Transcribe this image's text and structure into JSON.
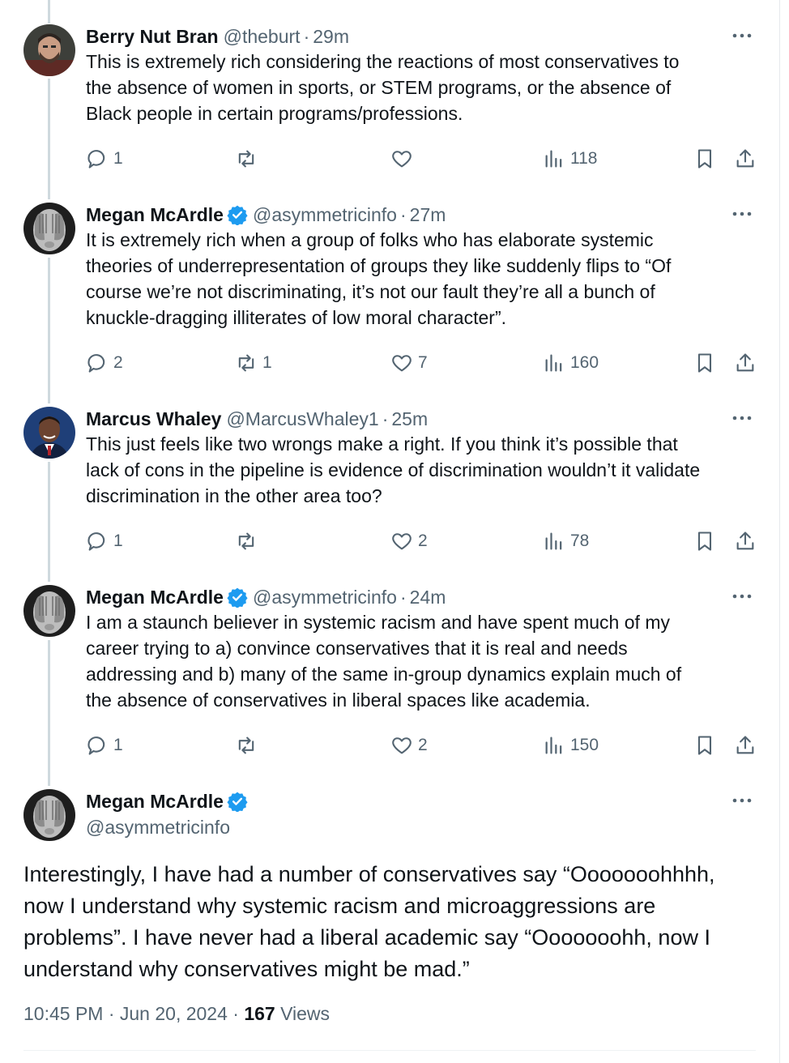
{
  "replies": [
    {
      "name": "Berry Nut Bran",
      "verified": false,
      "handle": "@theburt",
      "time": "29m",
      "lines": [
        "This is extremely rich considering the reactions of most conservatives to",
        "the absence of women in sports, or STEM programs, or the absence of",
        "Black people in certain programs/professions."
      ],
      "replies_count": "1",
      "reposts_count": "",
      "likes_count": "",
      "views_count": "118"
    },
    {
      "name": "Megan McArdle",
      "verified": true,
      "handle": "@asymmetricinfo",
      "time": "27m",
      "lines": [
        "It is extremely rich when a group of folks who has elaborate systemic",
        "theories of underrepresentation of groups they like suddenly flips to “Of",
        "course we’re not discriminating, it’s not our fault they’re all a bunch of",
        "knuckle-dragging illiterates of low moral character”."
      ],
      "replies_count": "2",
      "reposts_count": "1",
      "likes_count": "7",
      "views_count": "160"
    },
    {
      "name": "Marcus Whaley",
      "verified": false,
      "handle": "@MarcusWhaley1",
      "time": "25m",
      "lines": [
        "This just feels like two wrongs make a right.  If you think it’s possible that",
        "lack of cons in the pipeline is evidence of discrimination wouldn’t it validate",
        "discrimination in the other area too?"
      ],
      "replies_count": "1",
      "reposts_count": "",
      "likes_count": "2",
      "views_count": "78"
    },
    {
      "name": "Megan McArdle",
      "verified": true,
      "handle": "@asymmetricinfo",
      "time": "24m",
      "lines": [
        "I am a staunch believer in systemic racism and have spent much of my",
        "career trying to a) convince conservatives that it is real and needs",
        "addressing and b) many of the same in-group dynamics explain much of",
        "the absence of conservatives in liberal spaces like academia."
      ],
      "replies_count": "1",
      "reposts_count": "",
      "likes_count": "2",
      "views_count": "150"
    }
  ],
  "main": {
    "name": "Megan McArdle",
    "handle": "@asymmetricinfo",
    "lines": [
      "Interestingly, I have had a number of conservatives say “Ooooooohhhh,",
      "now I understand why systemic racism and microaggressions are",
      "problems”. I have never had a liberal academic say “Ooooooohh, now I",
      "understand why conservatives might be mad.”"
    ],
    "timestamp": "10:45 PM · Jun 20, 2024 · ",
    "views_count": "167",
    "views_label": " Views"
  },
  "colors": {
    "text": "#0f1419",
    "secondary": "#536471",
    "verified": "#1d9bf0",
    "thread_line": "#cfd9de"
  },
  "icons": {
    "reply": "speech-bubble-icon",
    "repost": "repost-arrows-icon",
    "like": "heart-icon",
    "views": "bar-chart-icon",
    "bookmark": "bookmark-icon",
    "share": "share-upload-icon",
    "more": "more-dots-icon",
    "verified": "verified-badge-icon"
  }
}
